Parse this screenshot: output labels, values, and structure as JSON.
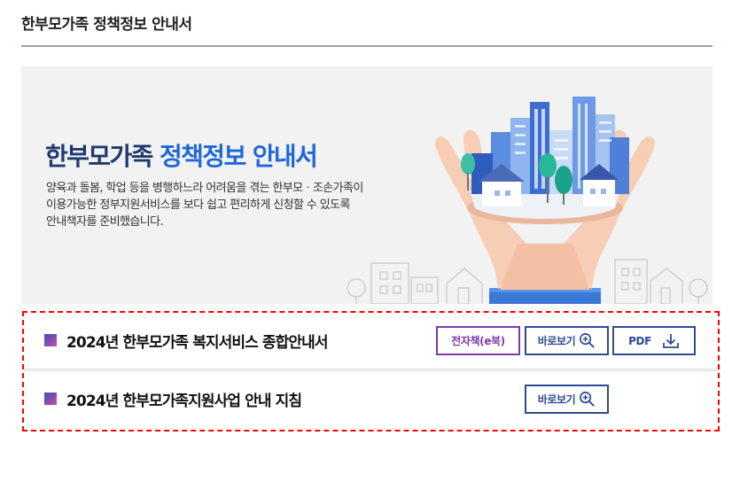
{
  "page": {
    "title": "한부모가족 정책정보 안내서"
  },
  "banner": {
    "heading_part1": "한부모가족",
    "heading_part2": "정책정보 안내서",
    "description_lines": [
      "양육과 돌봄, 학업 등을 병행하느라 어려움을 겪는 한부모ㆍ조손가족이",
      "이용가능한 정부지원서비스를 보다 쉽고 편리하게 신청할 수 있도록",
      "안내책자를 준비했습니다."
    ]
  },
  "documents": [
    {
      "title": "2024년 한부모가족 복지서비스 종합안내서",
      "buttons": {
        "ebook": "전자책(e북)",
        "view": "바로보기",
        "pdf": "PDF"
      }
    },
    {
      "title": "2024년 한부모가족지원사업 안내 지침",
      "buttons": {
        "view": "바로보기"
      }
    }
  ],
  "colors": {
    "heading_dark": "#1f3a6e",
    "heading_blue": "#1e68d8",
    "button_border": "#2d4a93",
    "ebook_border": "#7b3aa8",
    "highlight_dashed_border": "#ff0000",
    "banner_background": "#f2f2f3"
  },
  "icons": {
    "view_button_icon": "zoom-in-icon",
    "pdf_button_icon": "download-icon",
    "list_bullet": "square-bullet-icon"
  }
}
